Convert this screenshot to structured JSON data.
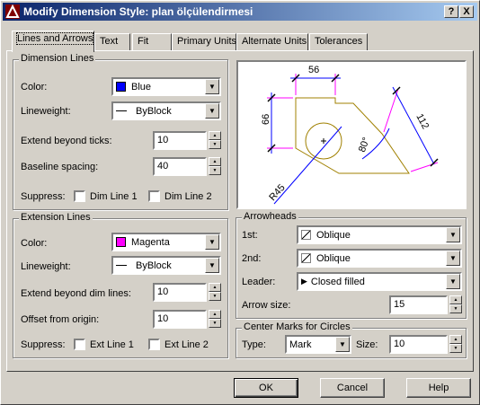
{
  "window": {
    "title": "Modify Dimension Style: plan ölçülendirmesi",
    "help_btn": "?",
    "close_btn": "X"
  },
  "tabs": [
    "Lines and Arrows",
    "Text",
    "Fit",
    "Primary Units",
    "Alternate Units",
    "Tolerances"
  ],
  "dimension_lines": {
    "title": "Dimension Lines",
    "color_label": "Color:",
    "color_value": "Blue",
    "color_hex": "#0000ff",
    "lineweight_label": "Lineweight:",
    "lineweight_value": "ByBlock",
    "extend_label": "Extend beyond ticks:",
    "extend_value": "10",
    "baseline_label": "Baseline spacing:",
    "baseline_value": "40",
    "suppress_label": "Suppress:",
    "dim1_label": "Dim Line 1",
    "dim2_label": "Dim Line 2"
  },
  "extension_lines": {
    "title": "Extension Lines",
    "color_label": "Color:",
    "color_value": "Magenta",
    "color_hex": "#ff00ff",
    "lineweight_label": "Lineweight:",
    "lineweight_value": "ByBlock",
    "extend_label": "Extend beyond dim lines:",
    "extend_value": "10",
    "offset_label": "Offset from origin:",
    "offset_value": "10",
    "suppress_label": "Suppress:",
    "ext1_label": "Ext Line 1",
    "ext2_label": "Ext Line 2"
  },
  "preview": {
    "dim_top": "56",
    "dim_left": "66",
    "dim_right": "112",
    "dim_angle": "80°",
    "dim_radius": "R45"
  },
  "arrowheads": {
    "title": "Arrowheads",
    "first_label": "1st:",
    "first_value": "Oblique",
    "second_label": "2nd:",
    "second_value": "Oblique",
    "leader_label": "Leader:",
    "leader_value": "Closed filled",
    "size_label": "Arrow size:",
    "size_value": "15"
  },
  "center_marks": {
    "title": "Center Marks for Circles",
    "type_label": "Type:",
    "type_value": "Mark",
    "size_label": "Size:",
    "size_value": "10"
  },
  "buttons": {
    "ok": "OK",
    "cancel": "Cancel",
    "help": "Help"
  }
}
